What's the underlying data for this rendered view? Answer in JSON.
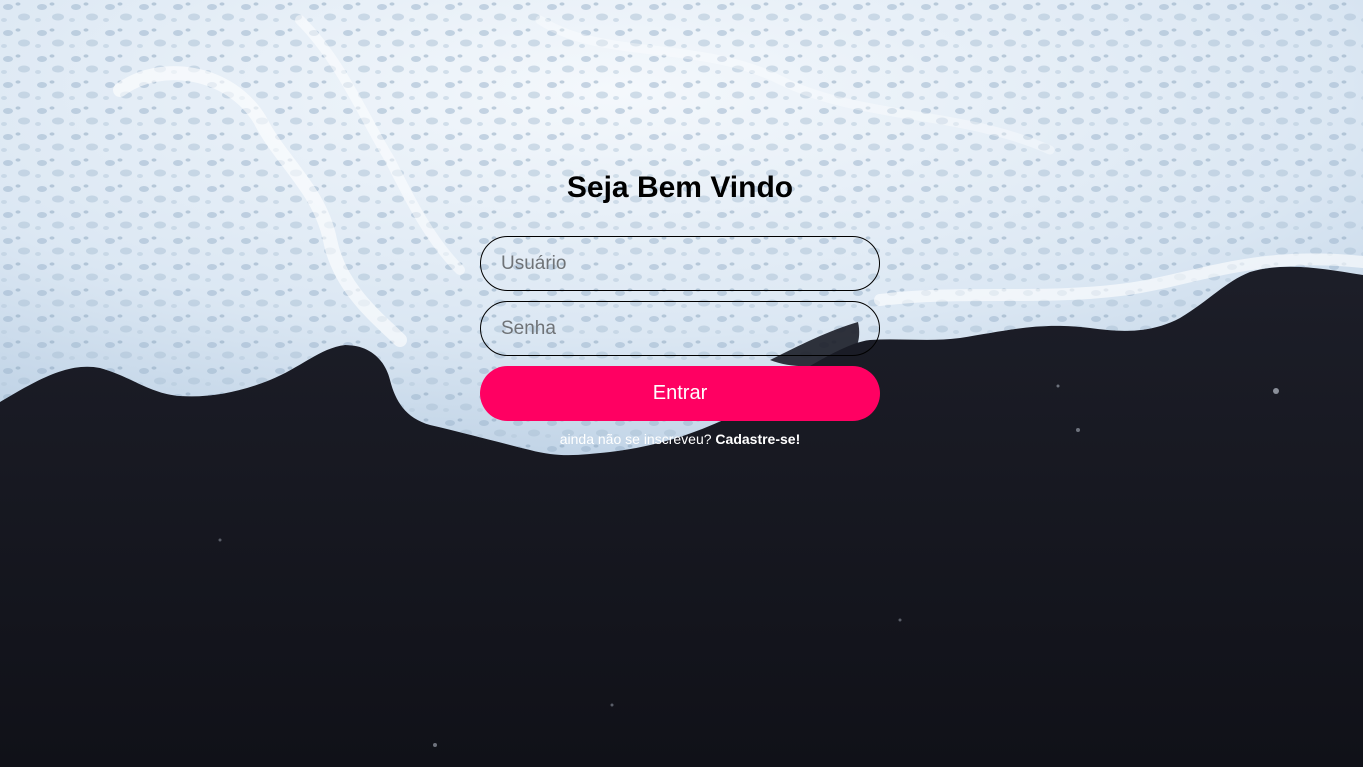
{
  "page": {
    "background": "black sand beach with white ocean foam (photo)"
  },
  "login": {
    "title": "Seja Bem Vindo",
    "username_placeholder": "Usuário",
    "password_placeholder": "Senha",
    "submit_label": "Entrar",
    "signup_prompt": "ainda não se inscreveu?",
    "signup_link": "Cadastre-se!"
  },
  "colors": {
    "button": "#ff0062",
    "sand": "#15161d",
    "foam": "#e6eff8",
    "title": "#000000"
  }
}
